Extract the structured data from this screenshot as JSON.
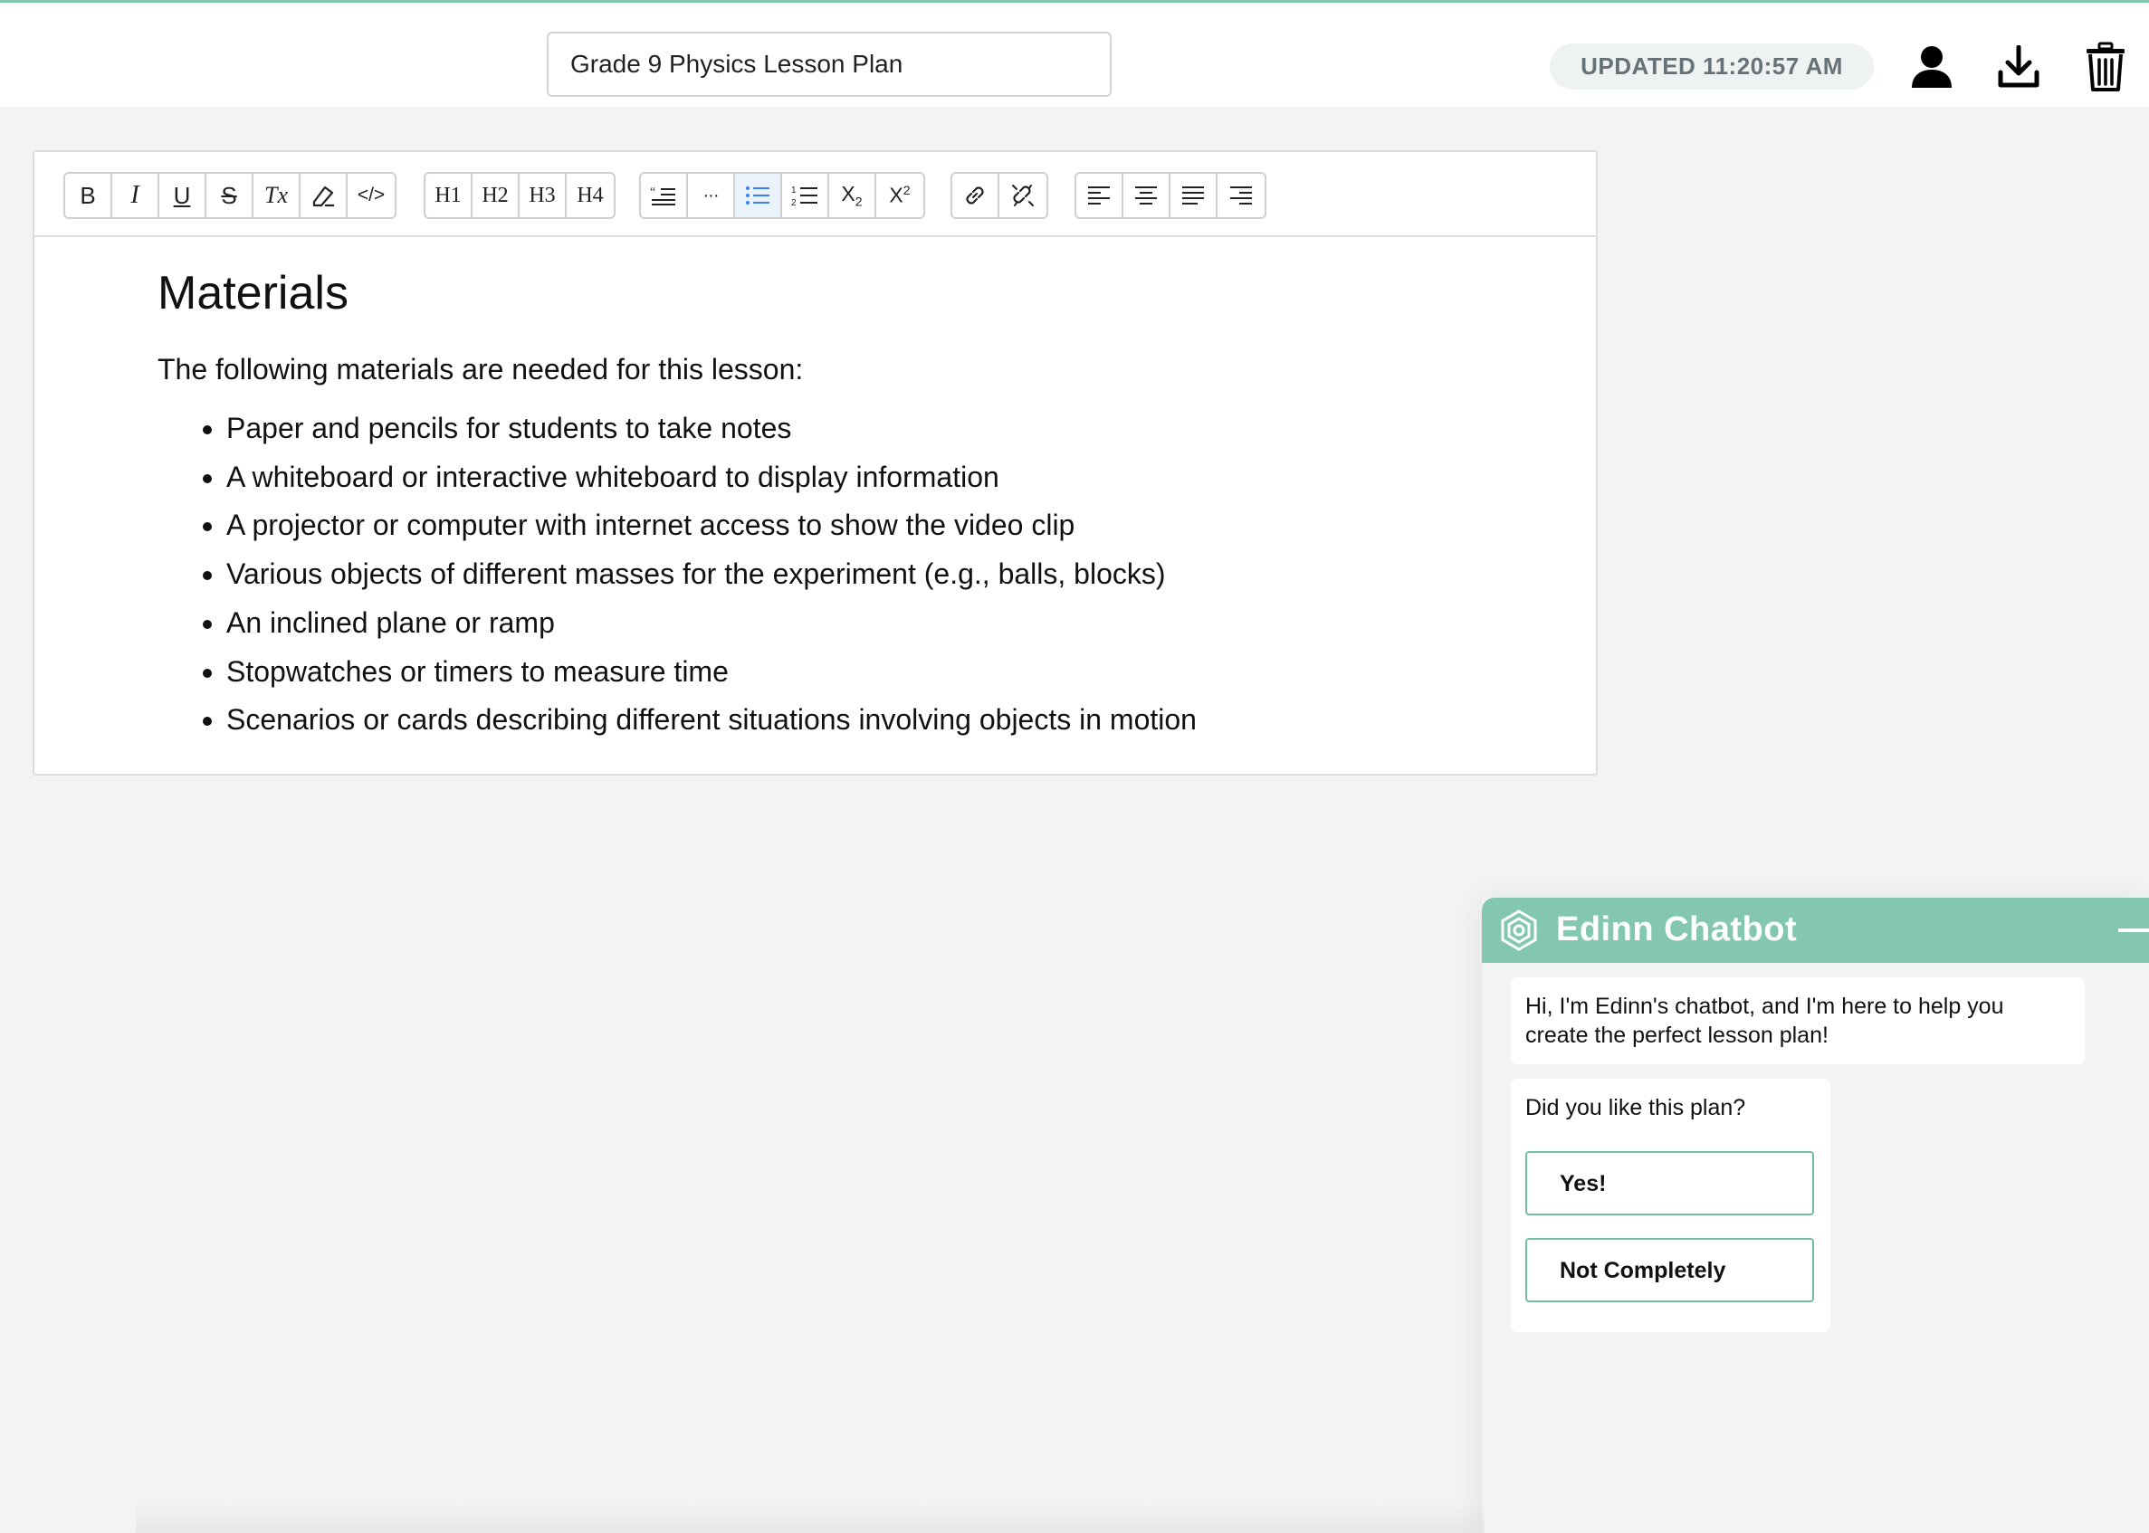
{
  "header": {
    "document_title": "Grade 9 Physics Lesson Plan",
    "updated_text": "UPDATED 11:20:57 AM",
    "icons": [
      "user-icon",
      "download-icon",
      "trash-icon"
    ]
  },
  "toolbar": {
    "groups": [
      [
        {
          "name": "bold",
          "label": "B"
        },
        {
          "name": "italic",
          "label": "I"
        },
        {
          "name": "underline",
          "label": "U"
        },
        {
          "name": "strikethrough",
          "label": "S"
        },
        {
          "name": "clear-format",
          "label": "Tx"
        },
        {
          "name": "highlight",
          "label": ""
        },
        {
          "name": "code",
          "label": "</>"
        }
      ],
      [
        {
          "name": "heading-1",
          "label": "H1"
        },
        {
          "name": "heading-2",
          "label": "H2"
        },
        {
          "name": "heading-3",
          "label": "H3"
        },
        {
          "name": "heading-4",
          "label": "H4"
        }
      ],
      [
        {
          "name": "blockquote",
          "label": ""
        },
        {
          "name": "horizontal-rule",
          "label": "···"
        },
        {
          "name": "bullet-list",
          "label": "",
          "active": true
        },
        {
          "name": "ordered-list",
          "label": ""
        },
        {
          "name": "subscript",
          "label": "X2"
        },
        {
          "name": "superscript",
          "label": "X2"
        }
      ],
      [
        {
          "name": "link",
          "label": ""
        },
        {
          "name": "unlink",
          "label": ""
        }
      ],
      [
        {
          "name": "align-left",
          "label": ""
        },
        {
          "name": "align-center",
          "label": ""
        },
        {
          "name": "align-justify",
          "label": ""
        },
        {
          "name": "align-right",
          "label": ""
        }
      ]
    ],
    "active_color": "#3b82f6"
  },
  "document": {
    "heading": "Materials",
    "intro": "The following materials are needed for this lesson:",
    "items": [
      "Paper and pencils for students to take notes",
      "A whiteboard or interactive whiteboard to display information",
      "A projector or computer with internet access to show the video clip",
      "Various objects of different masses for the experiment (e.g., balls, blocks)",
      "An inclined plane or ramp",
      "Stopwatches or timers to measure time",
      "Scenarios or cards describing different situations involving objects in motion"
    ]
  },
  "chatbot": {
    "title": "Edinn Chatbot",
    "header_color": "#83c7b1",
    "greeting": "Hi, I'm Edinn's chatbot, and I'm here to help you create the perfect lesson plan!",
    "question": "Did you like this plan?",
    "options": [
      "Yes!",
      "Not Completely"
    ]
  }
}
